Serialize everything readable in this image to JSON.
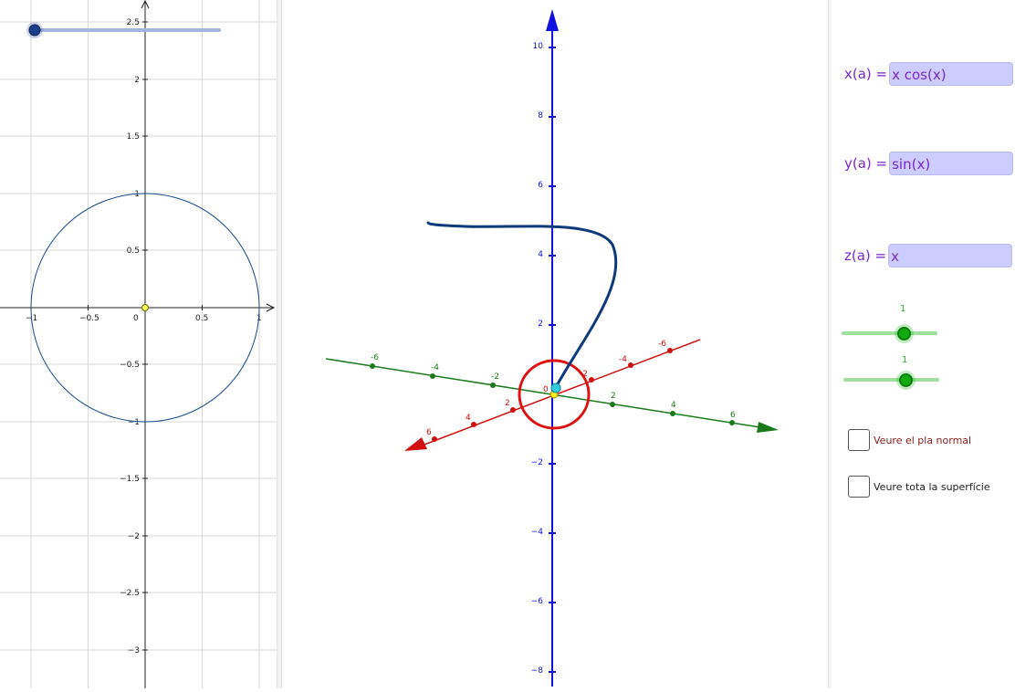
{
  "view2d": {
    "x_ticks": [
      "−1",
      "−0.5",
      "0",
      "0.5",
      "1"
    ],
    "y_ticks": [
      "2.5",
      "2",
      "1.5",
      "1",
      "0.5",
      "−0.5",
      "−1",
      "−1.5",
      "−2",
      "−2.5",
      "−3"
    ],
    "slider": {
      "value_fraction": 0.0,
      "track_color": "#a4b4dc",
      "knob_color": "#1a3d8a"
    },
    "curve": {
      "type": "circle",
      "radius": 1,
      "color": "#1a4a8f"
    }
  },
  "view3d": {
    "z_ticks": [
      "10",
      "8",
      "6",
      "4",
      "2",
      "−2",
      "−4",
      "−6",
      "−8"
    ],
    "x_ticks_red": [
      "-6",
      "-4",
      "-2",
      "2",
      "4",
      "6"
    ],
    "y_ticks_green": [
      "-6",
      "-4",
      "-2",
      "2",
      "4",
      "6"
    ],
    "origin_label": "0",
    "colors": {
      "x_axis": "#d01010",
      "y_axis": "#1a7a1a",
      "z_axis": "#1010e0",
      "curve": "#0d3a7a"
    }
  },
  "panel": {
    "equations": [
      {
        "label": "x(a) =",
        "value": "x cos(x)"
      },
      {
        "label": "y(a) =",
        "value": "sin(x)"
      },
      {
        "label": "z(a) =",
        "value": "x"
      }
    ],
    "sliders": [
      {
        "value": "1",
        "fraction": 0.65
      },
      {
        "value": "1",
        "fraction": 0.65
      }
    ],
    "checkboxes": [
      {
        "label": "Veure el pla normal",
        "checked": false,
        "color": "#8b1a1a"
      },
      {
        "label": "Veure tota la superfície",
        "checked": false,
        "color": "#222222"
      }
    ]
  }
}
